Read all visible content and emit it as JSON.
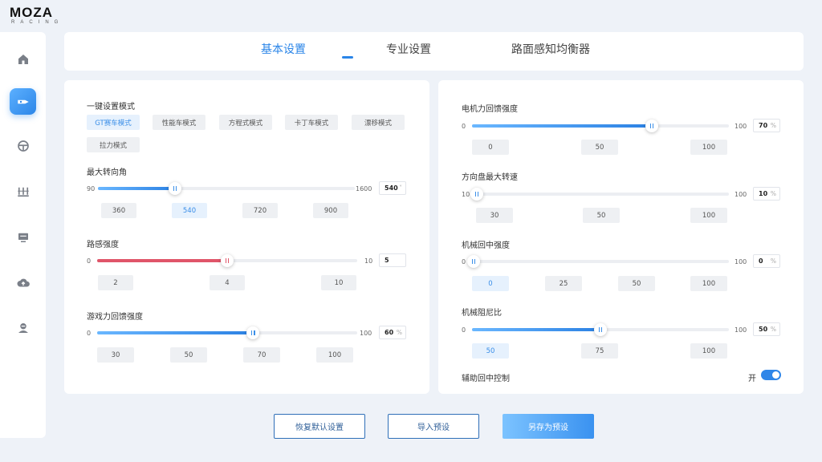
{
  "brand": {
    "name": "MOZA",
    "sub": "RACING"
  },
  "sidebar": {
    "items": [
      {
        "icon": "home-icon",
        "active": false
      },
      {
        "icon": "wheelbase-icon",
        "active": true
      },
      {
        "icon": "steering-wheel-icon",
        "active": false
      },
      {
        "icon": "pedals-icon",
        "active": false
      },
      {
        "icon": "display-icon",
        "active": false
      },
      {
        "icon": "cloud-upload-icon",
        "active": false
      },
      {
        "icon": "user-icon",
        "active": false
      }
    ]
  },
  "tabs": [
    {
      "label": "基本设置",
      "active": true
    },
    {
      "label": "专业设置",
      "active": false
    },
    {
      "label": "路面感知均衡器",
      "active": false
    }
  ],
  "left": {
    "mode": {
      "title": "一键设置模式",
      "options": [
        "GT赛车模式",
        "性能车模式",
        "方程式模式",
        "卡丁车模式",
        "漂移模式",
        "拉力模式"
      ],
      "selected": "GT赛车模式"
    },
    "steering_angle": {
      "title": "最大转向角",
      "min": "90",
      "max": "1600",
      "value": "540",
      "fraction": 0.3,
      "presets": [
        "360",
        "540",
        "720",
        "900"
      ],
      "selected": "540"
    },
    "road_feel": {
      "title": "路感强度",
      "min": "0",
      "max": "10",
      "value": "5",
      "fraction": 0.5,
      "presets": [
        "2",
        "4",
        "10"
      ]
    },
    "game_ffb": {
      "title": "游戏力回馈强度",
      "min": "0",
      "max": "100",
      "value": "60",
      "unit": "%",
      "fraction": 0.6,
      "presets": [
        "30",
        "50",
        "70",
        "100"
      ]
    }
  },
  "right": {
    "motor_ffb": {
      "title": "电机力回馈强度",
      "min": "0",
      "max": "100",
      "value": "70",
      "unit": "%",
      "fraction": 0.7,
      "presets": [
        "0",
        "50",
        "100"
      ]
    },
    "max_wheel_speed": {
      "title": "方向盘最大转速",
      "min": "10",
      "max": "100",
      "value": "10",
      "unit": "%",
      "fraction": 0.0,
      "presets": [
        "30",
        "50",
        "100"
      ]
    },
    "mech_centering": {
      "title": "机械回中强度",
      "min": "0",
      "max": "100",
      "value": "0",
      "unit": "%",
      "fraction": 0.0,
      "presets": [
        "0",
        "25",
        "50",
        "100"
      ],
      "selected": "0"
    },
    "mech_damping": {
      "title": "机械阻尼比",
      "min": "0",
      "max": "100",
      "value": "50",
      "unit": "%",
      "fraction": 0.5,
      "presets": [
        "50",
        "75",
        "100"
      ],
      "selected": "50"
    },
    "assist_centering": {
      "label": "辅助回中控制",
      "state_label": "开",
      "on": true
    }
  },
  "buttons": {
    "reset": "恢复默认设置",
    "import": "导入预设",
    "save_as": "另存为预设"
  }
}
